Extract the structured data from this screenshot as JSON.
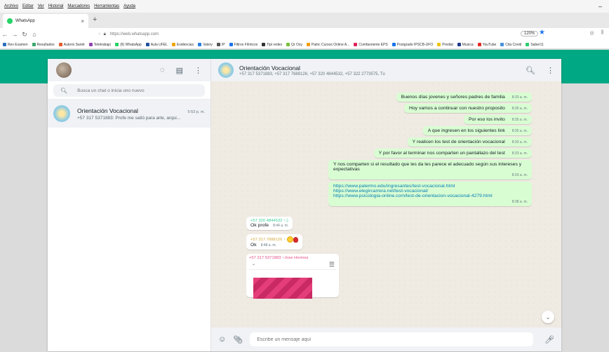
{
  "browser": {
    "menu": [
      "Archivo",
      "Editar",
      "Ver",
      "Historial",
      "Marcadores",
      "Herramientas",
      "Ayuda"
    ],
    "tab_title": "WhatsApp",
    "tab_close": "×",
    "new_tab": "+",
    "url": "https://web.whatsapp.com",
    "zoom": "120%",
    "bookmarks": [
      "Rev Examen",
      "Resultados",
      "Autorix Santé",
      "Teletrabajo",
      "(8) WhatsApp",
      "Aula UFEL",
      "Evidencias",
      "Valery",
      "IP",
      "Filtros Fílmicos",
      "Tipi redes",
      "Qr Oxy",
      "Patric Cursos Online A...",
      "Comfaoriente EPS",
      "Postgrado IPSCB-UFO",
      "Predial",
      "Musica",
      "YouTube",
      "Cita Covid",
      "Saber11"
    ]
  },
  "sidebar": {
    "search_placeholder": "Busca un chat o inicia uno nuevo",
    "chat": {
      "name": "Orientación Vocacional",
      "time": "5:53 p. m.",
      "preview": "+57 317 5371883: Profe me salió para arte, arqui..."
    }
  },
  "conversation": {
    "name": "Orientación Vocacional",
    "members": "+57 317 5371883, +57 317 7688126, +57 320 4844532, +57 322 2773575, Tú",
    "outgoing": [
      {
        "text": "Buenos días jovenes y señores padres de familia",
        "time": "8:33 a. m."
      },
      {
        "text": "Hoy vamos a continuar con nuestro proposito",
        "time": "8:35 a. m."
      },
      {
        "text": "Por eso los invito",
        "time": "8:35 a. m."
      },
      {
        "text": "A que ingresen en los siguientes link",
        "time": "8:35 a. m."
      },
      {
        "text": "Y realicen los test de orientación vocacional",
        "time": "8:33 a. m."
      },
      {
        "text": "Y por favor al terminar nos comparten un pantallazo del test",
        "time": "8:33 a. m."
      },
      {
        "text": "Y nos comparten si el resultado que les da les parece el adecuado según sus intereses y expectativas",
        "time": "8:33 a. m."
      }
    ],
    "links": {
      "urls": [
        "https://www.palermo.edu/ingresantes/test-vocacional.html",
        "https://www.elegircarrera.net/test-vocacional/",
        "https://www.psicologia-online.com/test-de-orientacion-vocacional-4279.html"
      ],
      "time": "8:38 a. m."
    },
    "incoming": [
      {
        "sender": "+57 320 4844532",
        "sender_suffix": "~;)",
        "text": "Ok profe",
        "time": "8:44 a. m."
      },
      {
        "sender": "+57 317 7688126",
        "sender_suffix": "~",
        "text": "Ok",
        "time": "8:48 a. m."
      },
      {
        "sender": "+57 317 5371883",
        "sender_suffix": "~Jose Hermes"
      }
    ],
    "composer_placeholder": "Escribe un mensaje aquí"
  }
}
